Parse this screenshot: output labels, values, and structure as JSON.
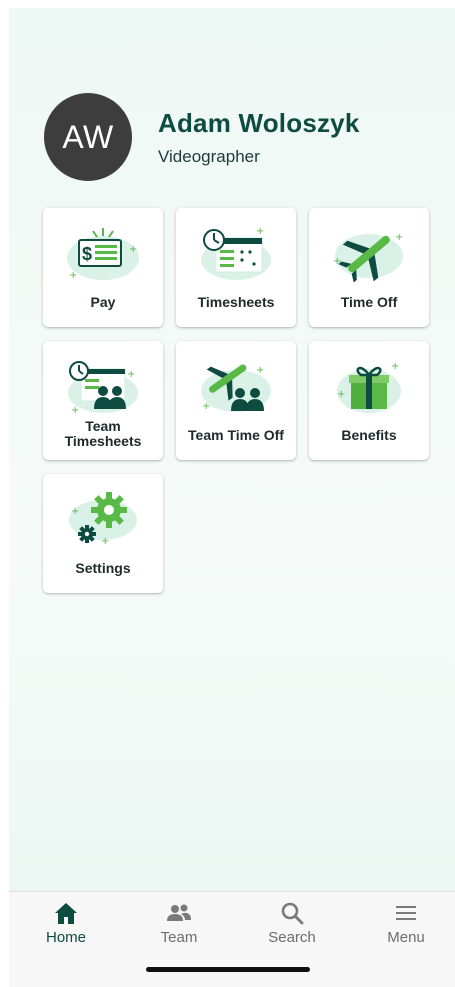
{
  "profile": {
    "initials": "AW",
    "name": "Adam Woloszyk",
    "title": "Videographer"
  },
  "tiles": [
    {
      "label": "Pay",
      "icon": "pay-icon"
    },
    {
      "label": "Timesheets",
      "icon": "timesheets-icon"
    },
    {
      "label": "Time Off",
      "icon": "airplane-icon"
    },
    {
      "label_line1": "Team",
      "label_line2": "Timesheets",
      "icon": "team-timesheets-icon"
    },
    {
      "label": "Team Time Off",
      "icon": "team-time-off-icon"
    },
    {
      "label": "Benefits",
      "icon": "gift-icon"
    },
    {
      "label": "Settings",
      "icon": "gear-icon"
    }
  ],
  "nav": {
    "items": [
      {
        "label": "Home",
        "icon": "home-icon",
        "active": true
      },
      {
        "label": "Team",
        "icon": "team-icon",
        "active": false
      },
      {
        "label": "Search",
        "icon": "search-icon",
        "active": false
      },
      {
        "label": "Menu",
        "icon": "menu-icon",
        "active": false
      }
    ]
  },
  "colors": {
    "brand_dark": "#0e4b41",
    "accent_green": "#58b947",
    "light_green": "#cfeede",
    "avatar_bg": "#3d3d3d"
  }
}
